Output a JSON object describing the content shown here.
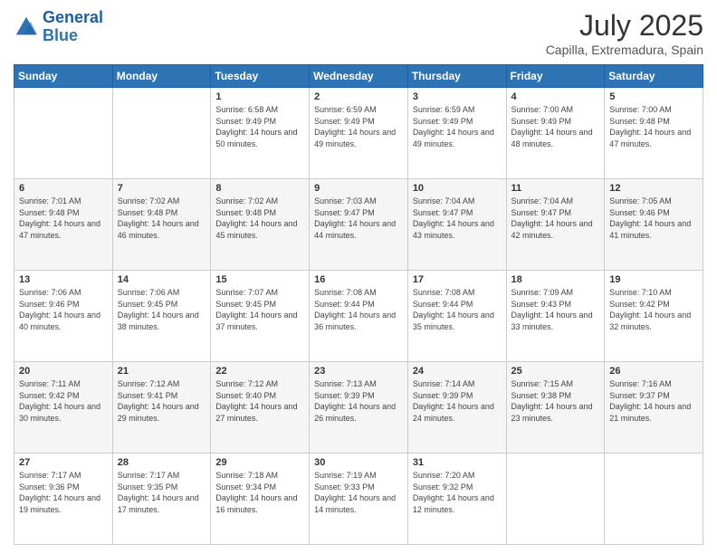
{
  "header": {
    "logo_line1": "General",
    "logo_line2": "Blue",
    "month_year": "July 2025",
    "location": "Capilla, Extremadura, Spain"
  },
  "days_of_week": [
    "Sunday",
    "Monday",
    "Tuesday",
    "Wednesday",
    "Thursday",
    "Friday",
    "Saturday"
  ],
  "weeks": [
    [
      {
        "day": "",
        "content": ""
      },
      {
        "day": "",
        "content": ""
      },
      {
        "day": "1",
        "content": "Sunrise: 6:58 AM\nSunset: 9:49 PM\nDaylight: 14 hours and 50 minutes."
      },
      {
        "day": "2",
        "content": "Sunrise: 6:59 AM\nSunset: 9:49 PM\nDaylight: 14 hours and 49 minutes."
      },
      {
        "day": "3",
        "content": "Sunrise: 6:59 AM\nSunset: 9:49 PM\nDaylight: 14 hours and 49 minutes."
      },
      {
        "day": "4",
        "content": "Sunrise: 7:00 AM\nSunset: 9:49 PM\nDaylight: 14 hours and 48 minutes."
      },
      {
        "day": "5",
        "content": "Sunrise: 7:00 AM\nSunset: 9:48 PM\nDaylight: 14 hours and 47 minutes."
      }
    ],
    [
      {
        "day": "6",
        "content": "Sunrise: 7:01 AM\nSunset: 9:48 PM\nDaylight: 14 hours and 47 minutes."
      },
      {
        "day": "7",
        "content": "Sunrise: 7:02 AM\nSunset: 9:48 PM\nDaylight: 14 hours and 46 minutes."
      },
      {
        "day": "8",
        "content": "Sunrise: 7:02 AM\nSunset: 9:48 PM\nDaylight: 14 hours and 45 minutes."
      },
      {
        "day": "9",
        "content": "Sunrise: 7:03 AM\nSunset: 9:47 PM\nDaylight: 14 hours and 44 minutes."
      },
      {
        "day": "10",
        "content": "Sunrise: 7:04 AM\nSunset: 9:47 PM\nDaylight: 14 hours and 43 minutes."
      },
      {
        "day": "11",
        "content": "Sunrise: 7:04 AM\nSunset: 9:47 PM\nDaylight: 14 hours and 42 minutes."
      },
      {
        "day": "12",
        "content": "Sunrise: 7:05 AM\nSunset: 9:46 PM\nDaylight: 14 hours and 41 minutes."
      }
    ],
    [
      {
        "day": "13",
        "content": "Sunrise: 7:06 AM\nSunset: 9:46 PM\nDaylight: 14 hours and 40 minutes."
      },
      {
        "day": "14",
        "content": "Sunrise: 7:06 AM\nSunset: 9:45 PM\nDaylight: 14 hours and 38 minutes."
      },
      {
        "day": "15",
        "content": "Sunrise: 7:07 AM\nSunset: 9:45 PM\nDaylight: 14 hours and 37 minutes."
      },
      {
        "day": "16",
        "content": "Sunrise: 7:08 AM\nSunset: 9:44 PM\nDaylight: 14 hours and 36 minutes."
      },
      {
        "day": "17",
        "content": "Sunrise: 7:08 AM\nSunset: 9:44 PM\nDaylight: 14 hours and 35 minutes."
      },
      {
        "day": "18",
        "content": "Sunrise: 7:09 AM\nSunset: 9:43 PM\nDaylight: 14 hours and 33 minutes."
      },
      {
        "day": "19",
        "content": "Sunrise: 7:10 AM\nSunset: 9:42 PM\nDaylight: 14 hours and 32 minutes."
      }
    ],
    [
      {
        "day": "20",
        "content": "Sunrise: 7:11 AM\nSunset: 9:42 PM\nDaylight: 14 hours and 30 minutes."
      },
      {
        "day": "21",
        "content": "Sunrise: 7:12 AM\nSunset: 9:41 PM\nDaylight: 14 hours and 29 minutes."
      },
      {
        "day": "22",
        "content": "Sunrise: 7:12 AM\nSunset: 9:40 PM\nDaylight: 14 hours and 27 minutes."
      },
      {
        "day": "23",
        "content": "Sunrise: 7:13 AM\nSunset: 9:39 PM\nDaylight: 14 hours and 26 minutes."
      },
      {
        "day": "24",
        "content": "Sunrise: 7:14 AM\nSunset: 9:39 PM\nDaylight: 14 hours and 24 minutes."
      },
      {
        "day": "25",
        "content": "Sunrise: 7:15 AM\nSunset: 9:38 PM\nDaylight: 14 hours and 23 minutes."
      },
      {
        "day": "26",
        "content": "Sunrise: 7:16 AM\nSunset: 9:37 PM\nDaylight: 14 hours and 21 minutes."
      }
    ],
    [
      {
        "day": "27",
        "content": "Sunrise: 7:17 AM\nSunset: 9:36 PM\nDaylight: 14 hours and 19 minutes."
      },
      {
        "day": "28",
        "content": "Sunrise: 7:17 AM\nSunset: 9:35 PM\nDaylight: 14 hours and 17 minutes."
      },
      {
        "day": "29",
        "content": "Sunrise: 7:18 AM\nSunset: 9:34 PM\nDaylight: 14 hours and 16 minutes."
      },
      {
        "day": "30",
        "content": "Sunrise: 7:19 AM\nSunset: 9:33 PM\nDaylight: 14 hours and 14 minutes."
      },
      {
        "day": "31",
        "content": "Sunrise: 7:20 AM\nSunset: 9:32 PM\nDaylight: 14 hours and 12 minutes."
      },
      {
        "day": "",
        "content": ""
      },
      {
        "day": "",
        "content": ""
      }
    ]
  ]
}
